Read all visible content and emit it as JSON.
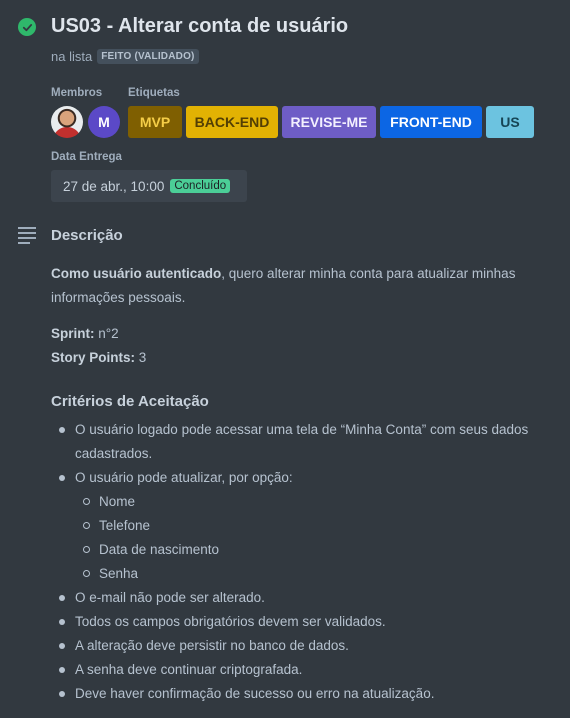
{
  "card": {
    "title": "US03 - Alterar conta de usuário",
    "list_prefix": "na lista",
    "list_name": "FEITO (VALIDADO)"
  },
  "members": {
    "label": "Membros",
    "avatar_initial": "M"
  },
  "labels": {
    "label": "Etiquetas",
    "items": [
      {
        "text": "MVP",
        "bg": "#7f5f01",
        "fg": "#f5cd47"
      },
      {
        "text": "BACK-END",
        "bg": "#e2b203",
        "fg": "#533f04"
      },
      {
        "text": "REVISE-ME",
        "bg": "#6e5dc6",
        "fg": "#f3f0ff"
      },
      {
        "text": "FRONT-END",
        "bg": "#0c66e4",
        "fg": "#ffffff"
      },
      {
        "text": "US",
        "bg": "#6cc3e0",
        "fg": "#164555"
      }
    ]
  },
  "due": {
    "label": "Data Entrega",
    "date": "27 de abr., 10:00",
    "status": "Concluído"
  },
  "description": {
    "heading": "Descrição",
    "intro_bold": "Como usuário autenticado",
    "intro_rest_1": ", quero alterar minha conta para atualizar minhas",
    "intro_rest_2": "informações pessoais.",
    "sprint_label": "Sprint:",
    "sprint_value": " n°2",
    "points_label": "Story Points:",
    "points_value": " 3",
    "criteria_heading": "Critérios de Aceitação",
    "criteria": [
      "O usuário logado pode acessar uma tela de “Minha Conta” com seus dados",
      "cadastrados.",
      "O usuário pode atualizar, por opção:",
      "Nome",
      "Telefone",
      "Data de nascimento",
      "Senha",
      "O e-mail não pode ser alterado.",
      "Todos os campos obrigatórios devem ser validados.",
      "A alteração deve persistir no banco de dados.",
      "A senha deve continuar criptografada.",
      "Deve haver confirmação de sucesso ou erro na atualização."
    ]
  },
  "colors": {
    "background": "#323940",
    "complete_green": "#2fb86b",
    "done_badge": "#4bce97"
  }
}
